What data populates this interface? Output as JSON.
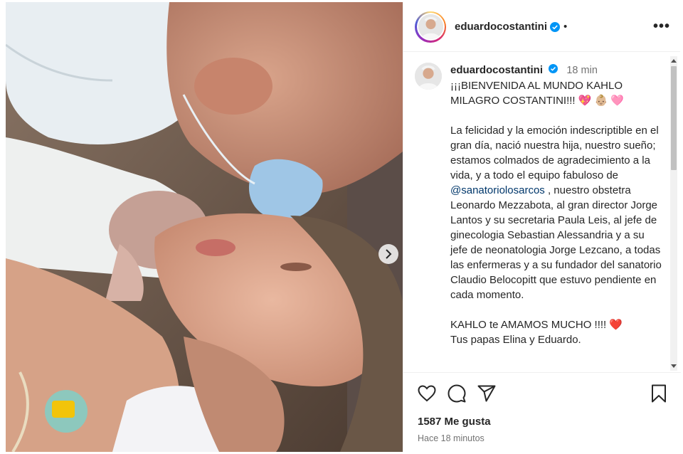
{
  "post": {
    "username": "eduardocostantini",
    "dot": "•",
    "more_label": "•••"
  },
  "caption": {
    "username": "eduardocostantini",
    "time": "18 min",
    "headline": "¡¡¡BIENVENIDA AL MUNDO KAHLO MILAGRO COSTANTINI!!! 💖 👶🏼 🩷",
    "body_before_mention": "La felicidad y la emoción indescriptible en el gran día, nació nuestra hija, nuestro sueño; estamos colmados de agradecimiento a la vida, y a todo el equipo fabuloso de ",
    "mention": "@sanatoriolosarcos",
    "body_after_mention": " , nuestro obstetra Leonardo Mezzabota, al gran director Jorge Lantos y su secretaria Paula Leis, al jefe de ginecologia Sebastian Alessandria y a su jefe de neonatologia Jorge Lezcano, a todas las enfermeras y a su fundador del sanatorio Claudio Belocopitt que estuvo pendiente en cada momento.",
    "closing_line1": "KAHLO te AMAMOS MUCHO !!!! ❤️",
    "closing_line2": "Tus papas Elina y Eduardo."
  },
  "engagement": {
    "likes": "1587 Me gusta",
    "posted_ago": "Hace 18 minutos"
  },
  "icons": {
    "verified": "verified-badge-icon",
    "like": "heart-icon",
    "comment": "comment-icon",
    "share": "paper-plane-icon",
    "save": "bookmark-icon",
    "carousel": "chevron-right-icon"
  },
  "colors": {
    "verified_blue": "#0095f6",
    "mention": "#00376b",
    "muted_text": "#737373"
  }
}
